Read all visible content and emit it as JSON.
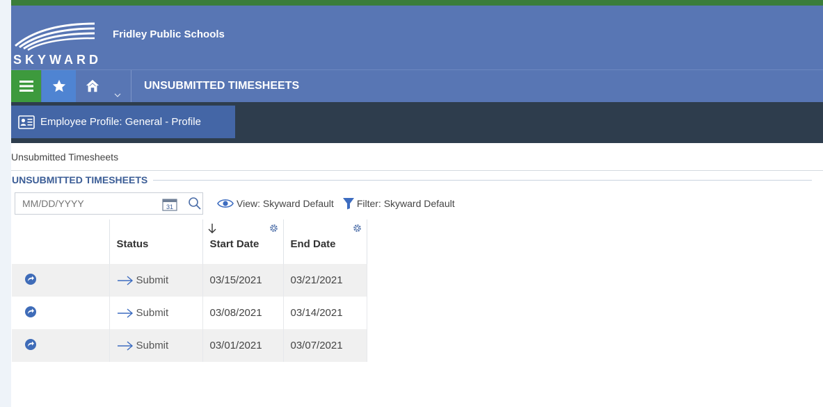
{
  "app": {
    "district_name": "Fridley Public Schools",
    "logo_text": "SKYWARD"
  },
  "nav": {
    "page_title": "UNSUBMITTED TIMESHEETS"
  },
  "tabs": [
    {
      "label": "Employee Profile: General - Profile"
    }
  ],
  "breadcrumb": "Unsubmitted Timesheets",
  "section": {
    "title": "UNSUBMITTED TIMESHEETS"
  },
  "toolbar": {
    "date_placeholder": "MM/DD/YYYY",
    "view_label": "View: Skyward Default",
    "filter_label": "Filter: Skyward Default"
  },
  "table": {
    "headers": [
      "",
      "Status",
      "Start Date",
      "End Date"
    ],
    "sort": {
      "column": "Start Date",
      "direction": "descending"
    },
    "rows": [
      {
        "status": "Submit",
        "start": "03/15/2021",
        "end": "03/21/2021"
      },
      {
        "status": "Submit",
        "start": "03/08/2021",
        "end": "03/14/2021"
      },
      {
        "status": "Submit",
        "start": "03/01/2021",
        "end": "03/07/2021"
      }
    ]
  },
  "colors": {
    "header_blue": "#5876b4",
    "menu_green": "#3d9a3d",
    "favorite_blue": "#4f84d2",
    "tabbar_dark": "#2e3d4d",
    "section_title": "#3b5d96"
  },
  "icons": {
    "menu": "hamburger-icon",
    "favorite": "star-icon",
    "home": "home-icon",
    "profile": "id-card-icon",
    "calendar": "calendar-icon",
    "search": "search-icon",
    "view": "eye-icon",
    "filter": "funnel-icon",
    "row_action": "circle-arrow-icon",
    "submit": "right-arrow-icon"
  }
}
